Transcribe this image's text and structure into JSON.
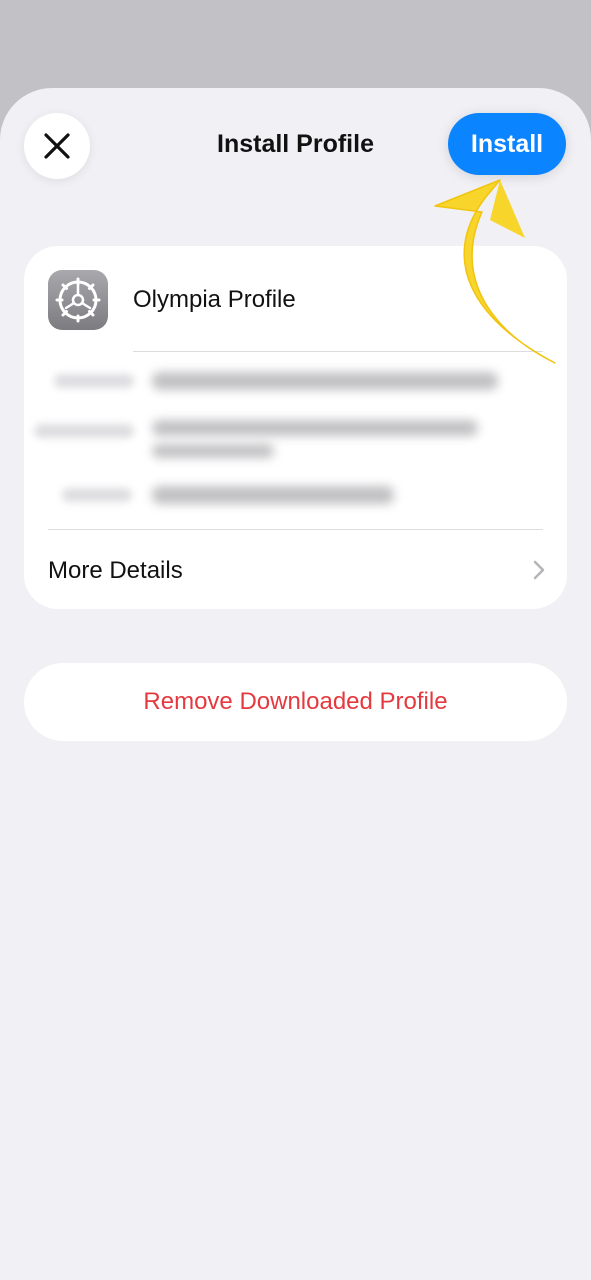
{
  "header": {
    "title": "Install Profile",
    "install_label": "Install"
  },
  "profile": {
    "name": "Olympia Profile",
    "icon": "settings-gear-icon"
  },
  "details": {
    "more_label": "More Details"
  },
  "actions": {
    "remove_label": "Remove Downloaded Profile"
  },
  "colors": {
    "accent": "#0a84ff",
    "destructive": "#e5393f",
    "annotation_arrow": "#f7d52b"
  }
}
